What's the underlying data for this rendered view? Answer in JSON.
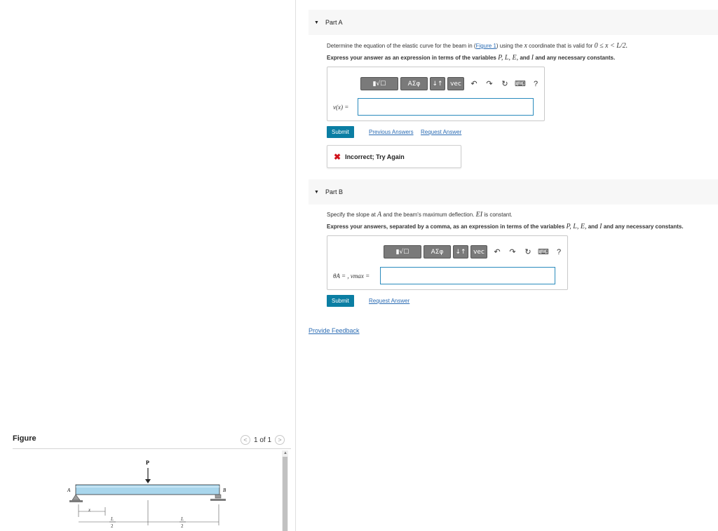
{
  "figure_panel": {
    "title": "Figure",
    "pager_text": "1 of 1",
    "prev_symbol": "<",
    "next_symbol": ">",
    "labels": {
      "load": "P",
      "left_support": "A",
      "right_support": "B",
      "x": "x",
      "half": "L",
      "two": "2"
    }
  },
  "partA": {
    "header": "Part A",
    "q1_pre": "Determine the equation of the elastic curve for the beam in (",
    "q1_link": "Figure 1",
    "q1_mid": ") using the ",
    "q1_var": "x",
    "q1_post": " coordinate that is valid for ",
    "q1_range": "0 ≤ x < L/2.",
    "q2_pre": "Express your answer as an expression in terms of the variables ",
    "q2_vars": "P, L, E,",
    "q2_and": " and ",
    "q2_var_i": "I",
    "q2_post": " and any necessary constants.",
    "input_label": "v(x) =",
    "input_value": "",
    "submit": "Submit",
    "prev_answers": "Previous Answers",
    "request_answer": "Request Answer",
    "feedback": "Incorrect; Try Again"
  },
  "partB": {
    "header": "Part B",
    "q1_pre": "Specify the slope at ",
    "q1_var_a": "A",
    "q1_mid": " and the beam's maximum deflection. ",
    "q1_var_ei": "EI",
    "q1_post": " is constant.",
    "q2_pre": "Express your answers, separated by a comma, as an expression in terms of the variables ",
    "q2_vars": "P, L, E,",
    "q2_and": " and ",
    "q2_var_i": "I",
    "q2_post": " and any necessary constants.",
    "input_label": "θA = , vmax =",
    "input_value": "",
    "submit": "Submit",
    "request_answer": "Request Answer"
  },
  "toolbar": {
    "templates": "▮√☐",
    "greek": "ΑΣφ",
    "arrows": "↓↑",
    "vec": "vec",
    "undo": "↶",
    "redo": "↷",
    "reset": "↻",
    "keyboard": "⌨",
    "help": "?"
  },
  "provide_feedback": "Provide Feedback",
  "colors": {
    "accent": "#0b7ea3",
    "link": "#2a6bb3",
    "error": "#d0121b",
    "beam": "#a9d6ec"
  }
}
